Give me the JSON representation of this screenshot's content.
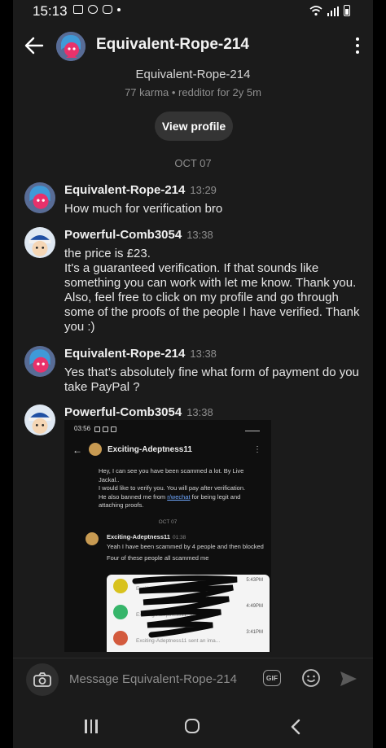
{
  "status_bar": {
    "time": "15:13"
  },
  "header": {
    "title": "Equivalent-Rope-214"
  },
  "profile": {
    "name": "Equivalent-Rope-214",
    "meta": "77 karma • redditor for 2y 5m",
    "view_profile_label": "View profile"
  },
  "date_separator": "OCT 07",
  "messages": [
    {
      "author": "Equivalent-Rope-214",
      "time": "13:29",
      "text": "How much for verification bro"
    },
    {
      "author": "Powerful-Comb3054",
      "time": "13:38",
      "text": "the price is £23.\nIt's a guaranteed verification. If that sounds like something you can work with let me know. Thank you. Also, feel free to click on my profile and go through some of the proofs of the people I have verified. Thank you :)"
    },
    {
      "author": "Equivalent-Rope-214",
      "time": "13:38",
      "text": "Yes that’s absolutely fine what form of payment do you take PayPal ?"
    },
    {
      "author": "Powerful-Comb3054",
      "time": "13:38",
      "text": ""
    }
  ],
  "attachment": {
    "status_time": "03:56",
    "title": "Exciting-Adeptness11",
    "text_1": "Hey, I can see you have been scammed a lot. By Live Jackal..",
    "text_2": "I would like to verify you. You will pay after verification.",
    "text_3a": "He also banned me from ",
    "text_3_link": "r/wechat",
    "text_3b": " for being legit and attaching proofs.",
    "date": "OCT 07",
    "author": "Exciting-Adeptness11",
    "author_time": "01:38",
    "msg_1": "Yeah I have been scammed by 4 people and then blocked",
    "msg_2": "Four of these people all scammed me",
    "card_rows": [
      {
        "time": "5:43PM",
        "line": "Exciting-Adeptness11: Ar... ...ve..."
      },
      {
        "time": "4:49PM",
        "line": "Exciting-Adeptness11: What the f..."
      },
      {
        "time": "3:41PM",
        "line": "Exciting-Adeptness11 sent an ima..."
      }
    ]
  },
  "composer": {
    "placeholder": "Message Equivalent-Rope-214",
    "gif_label": "GIF"
  }
}
